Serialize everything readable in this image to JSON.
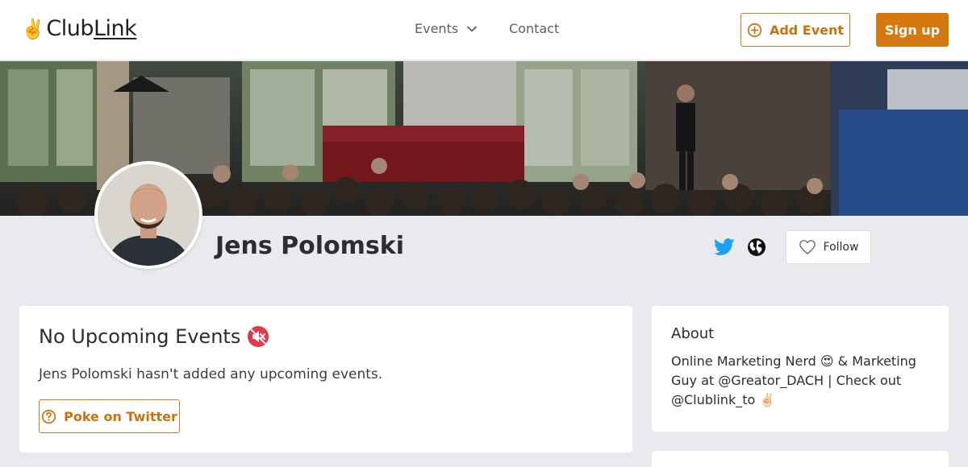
{
  "header": {
    "logo": {
      "prefix": "Club",
      "link": "Link",
      "hand_emoji": "✌️"
    },
    "nav": {
      "events_label": "Events",
      "contact_label": "Contact"
    },
    "add_event_label": "Add Event",
    "signup_label": "Sign up"
  },
  "profile": {
    "name": "Jens Polomski",
    "follow_label": "Follow"
  },
  "events_card": {
    "title": "No Upcoming Events",
    "title_emoji": "🔇",
    "message": "Jens Polomski hasn't added any upcoming events.",
    "poke_label": "Poke on Twitter"
  },
  "about_card": {
    "title": "About",
    "text": "Online Marketing Nerd 😍 & Marketing Guy at @Greator_DACH | Check out @Clublink_to ✌🏻"
  },
  "colors": {
    "accent": "#d4780f",
    "twitter": "#1da1f2",
    "background": "#e9eaed"
  },
  "icons": [
    "chevron-down-icon",
    "plus-circle-icon",
    "twitter-icon",
    "globe-icon",
    "heart-icon",
    "mute-icon",
    "question-circle-icon"
  ]
}
